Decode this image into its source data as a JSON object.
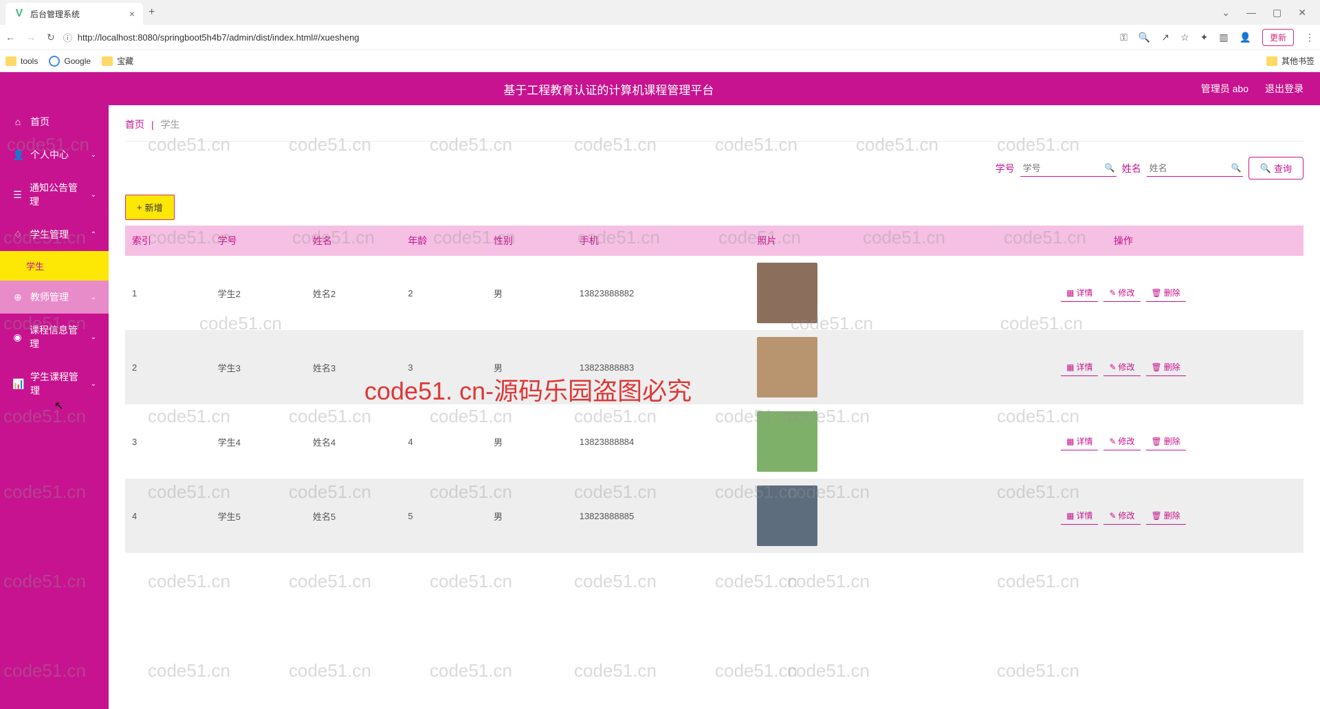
{
  "browser": {
    "tab_title": "后台管理系统",
    "url": "http://localhost:8080/springboot5h4b7/admin/dist/index.html#/xuesheng",
    "update_label": "更新",
    "bookmarks": {
      "tools": "tools",
      "google": "Google",
      "treasure": "宝藏",
      "other": "其他书签"
    }
  },
  "header": {
    "title": "基于工程教育认证的计算机课程管理平台",
    "admin": "管理员 abo",
    "logout": "退出登录"
  },
  "sidebar": {
    "items": [
      {
        "icon": "⌂",
        "label": "首页"
      },
      {
        "icon": "👤",
        "label": "个人中心",
        "chev": "⌄"
      },
      {
        "icon": "☰",
        "label": "通知公告管理",
        "chev": "⌄"
      },
      {
        "icon": "♢",
        "label": "学生管理",
        "chev": "⌃"
      },
      {
        "icon": "⊕",
        "label": "教师管理",
        "chev": "⌄"
      },
      {
        "icon": "◉",
        "label": "课程信息管理",
        "chev": "⌄"
      },
      {
        "icon": "📊",
        "label": "学生课程管理",
        "chev": "⌄"
      }
    ],
    "submenu_student": "学生"
  },
  "breadcrumb": {
    "home": "首页",
    "current": "学生"
  },
  "search": {
    "field1_label": "学号",
    "field1_placeholder": "学号",
    "field2_label": "姓名",
    "field2_placeholder": "姓名",
    "query_btn": "查询"
  },
  "add_btn": "新增",
  "table": {
    "headers": [
      "索引",
      "学号",
      "姓名",
      "年龄",
      "性别",
      "手机",
      "照片",
      "操作"
    ],
    "actions": {
      "detail": "详情",
      "edit": "修改",
      "delete": "删除"
    },
    "rows": [
      {
        "idx": "1",
        "sno": "学生2",
        "name": "姓名2",
        "age": "2",
        "gender": "男",
        "phone": "13823888882"
      },
      {
        "idx": "2",
        "sno": "学生3",
        "name": "姓名3",
        "age": "3",
        "gender": "男",
        "phone": "13823888883"
      },
      {
        "idx": "3",
        "sno": "学生4",
        "name": "姓名4",
        "age": "4",
        "gender": "男",
        "phone": "13823888884"
      },
      {
        "idx": "4",
        "sno": "学生5",
        "name": "姓名5",
        "age": "5",
        "gender": "男",
        "phone": "13823888885"
      }
    ]
  },
  "watermark": {
    "main": "code51. cn-源码乐园盗图必究",
    "bg": "code51.cn"
  }
}
